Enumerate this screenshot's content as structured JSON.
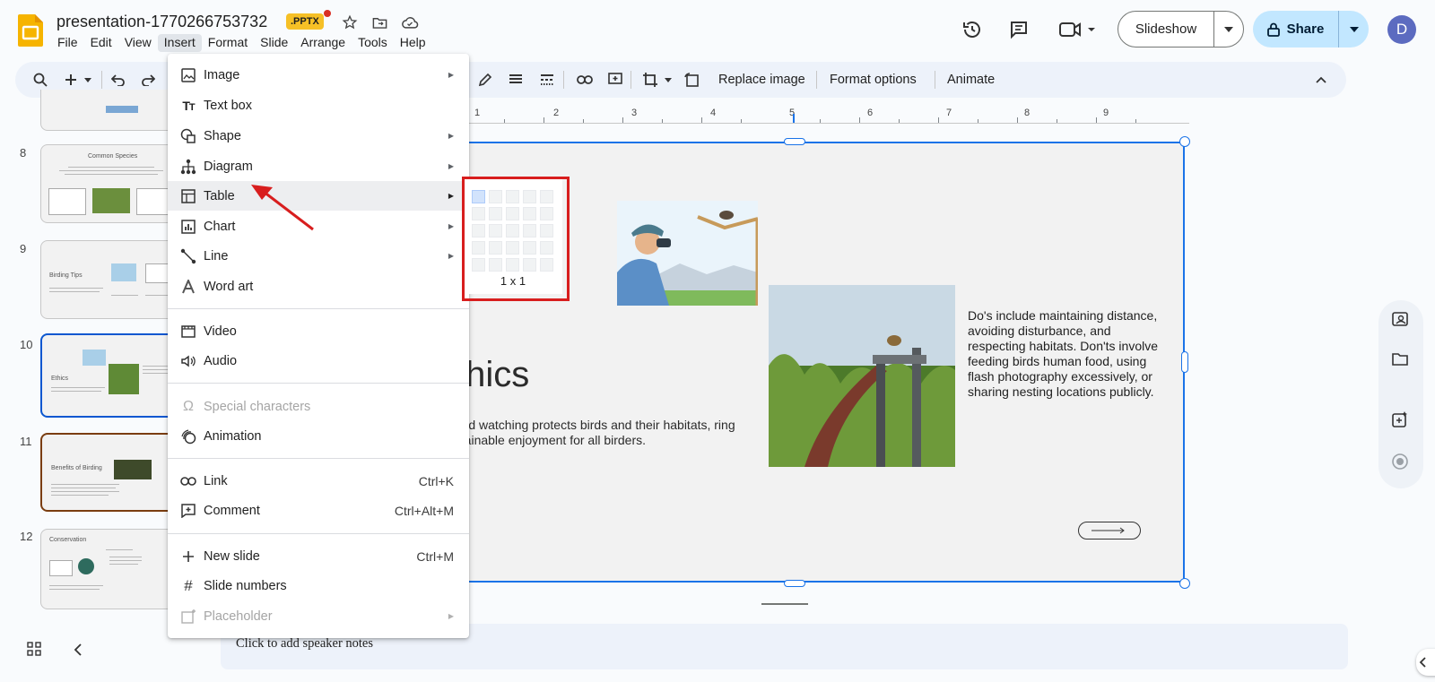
{
  "app": {
    "doc_title": "presentation-1770266753732",
    "badge": ".PPTX",
    "menubar": [
      "File",
      "Edit",
      "View",
      "Insert",
      "Format",
      "Slide",
      "Arrange",
      "Tools",
      "Help"
    ],
    "active_menu": "Insert",
    "slideshow_label": "Slideshow",
    "share_label": "Share",
    "avatar_initial": "D"
  },
  "toolbar": {
    "replace_image": "Replace image",
    "format_options": "Format options",
    "animate": "Animate"
  },
  "ruler": [
    "1",
    "1",
    "2",
    "3",
    "4",
    "5",
    "6",
    "7",
    "8",
    "9"
  ],
  "filmstrip": {
    "slides": [
      {
        "num": "8",
        "title": "Common Species"
      },
      {
        "num": "9",
        "title": "Birding Tips"
      },
      {
        "num": "10",
        "title": "Ethics"
      },
      {
        "num": "11",
        "title": "Benefits of Birding"
      },
      {
        "num": "12",
        "title": "Conservation"
      }
    ]
  },
  "slide": {
    "heading_visible": "thics",
    "subtitle": "al bird watching protects birds and their habitats, ring sustainable enjoyment for all birders.",
    "paragraph": "Do's include maintaining distance, avoiding disturbance, and respecting habitats. Don'ts involve feeding birds human food, using flash photography excessively, or sharing nesting locations publicly."
  },
  "notes_placeholder": "Click to add speaker notes",
  "insert_menu": {
    "items": [
      {
        "label": "Image",
        "icon": "image-icon",
        "submenu": true
      },
      {
        "label": "Text box",
        "icon": "text-box-icon"
      },
      {
        "label": "Shape",
        "icon": "shape-icon",
        "submenu": true
      },
      {
        "label": "Diagram",
        "icon": "diagram-icon",
        "submenu": true
      },
      {
        "label": "Table",
        "icon": "table-icon",
        "submenu": true
      },
      {
        "label": "Chart",
        "icon": "chart-icon",
        "submenu": true
      },
      {
        "label": "Line",
        "icon": "line-icon",
        "submenu": true
      },
      {
        "label": "Word art",
        "icon": "word-art-icon"
      },
      {
        "label": "Video",
        "icon": "video-icon"
      },
      {
        "label": "Audio",
        "icon": "audio-icon"
      },
      {
        "label": "Special characters",
        "icon": "omega-icon",
        "disabled": true
      },
      {
        "label": "Animation",
        "icon": "animation-icon"
      },
      {
        "label": "Link",
        "icon": "link-icon",
        "shortcut": "Ctrl+K"
      },
      {
        "label": "Comment",
        "icon": "comment-add-icon",
        "shortcut": "Ctrl+Alt+M"
      },
      {
        "label": "New slide",
        "icon": "plus-icon",
        "shortcut": "Ctrl+M"
      },
      {
        "label": "Slide numbers",
        "icon": "hash-icon"
      },
      {
        "label": "Placeholder",
        "icon": "placeholder-icon",
        "submenu": true,
        "disabled": true
      }
    ],
    "hovered": "Table"
  },
  "table_picker": {
    "size_label": "1 x 1",
    "rows": 5,
    "cols": 5,
    "selected_rows": 1,
    "selected_cols": 1
  },
  "colors": {
    "accent": "#1a73e8",
    "annotation": "#d81e1e",
    "share_bg": "#c2e7ff"
  }
}
